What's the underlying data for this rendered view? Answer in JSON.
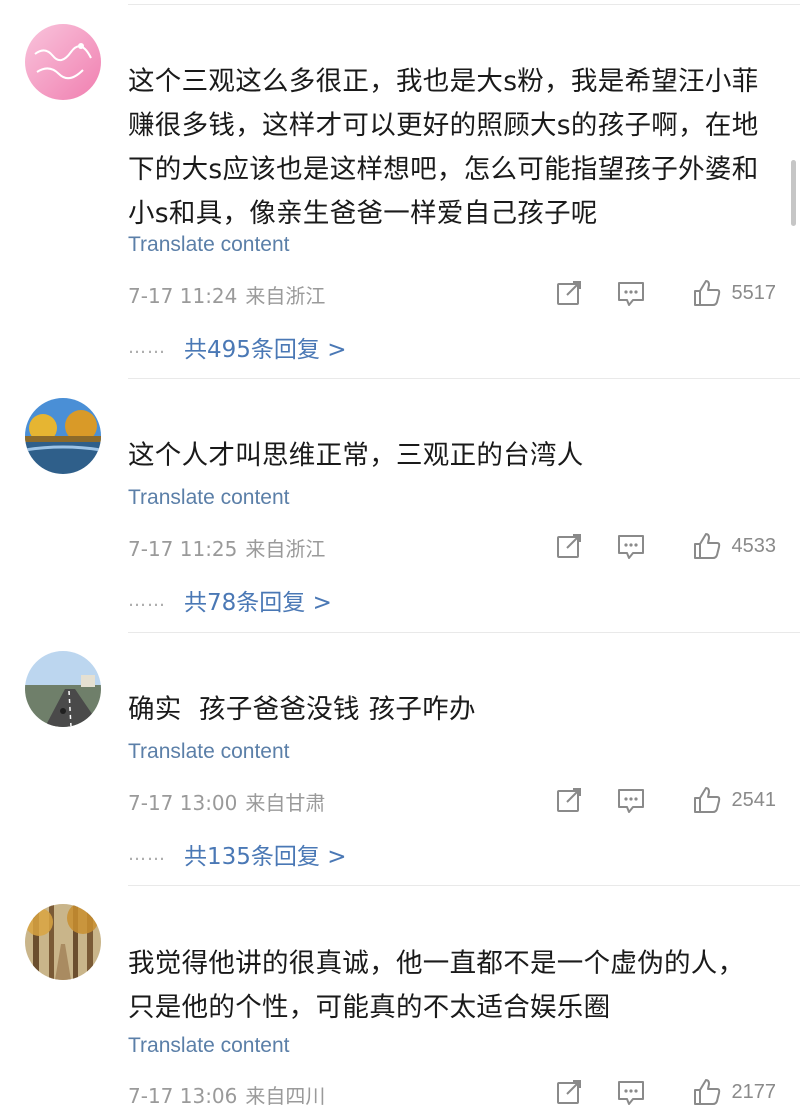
{
  "comments": [
    {
      "text": "这个三观这么多很正，我也是大s粉，我是希望汪小菲赚很多钱，这样才可以更好的照顾大s的孩子啊，在地下的大s应该也是这样想吧，怎么可能指望孩子外婆和小s和具，像亲生爸爸一样爱自己孩子呢",
      "translate": "Translate content",
      "date": "7-17 11:24",
      "location": "来自浙江",
      "likes": "5517",
      "replies": "共495条回复 >"
    },
    {
      "text": "这个人才叫思维正常，三观正的台湾人",
      "translate": "Translate content",
      "date": "7-17 11:25",
      "location": "来自浙江",
      "likes": "4533",
      "replies": "共78条回复 >"
    },
    {
      "text": "确实  孩子爸爸没钱 孩子咋办",
      "translate": "Translate content",
      "date": "7-17 13:00",
      "location": "来自甘肃",
      "likes": "2541",
      "replies": "共135条回复 >"
    },
    {
      "text": "我觉得他讲的很真诚，他一直都不是一个虚伪的人，只是他的个性，可能真的不太适合娱乐圈",
      "translate": "Translate content",
      "date": "7-17 13:06",
      "location": "来自四川",
      "likes": "2177"
    }
  ],
  "reply_dots": "……",
  "icons": {
    "repost": "share-box-icon",
    "comment": "comment-bubble-icon",
    "like": "thumbs-up-icon"
  },
  "colors": {
    "link": "#4a78b5",
    "translate": "#5b7fa8",
    "meta": "#9a9a9a",
    "icon": "#8a8a8a"
  }
}
